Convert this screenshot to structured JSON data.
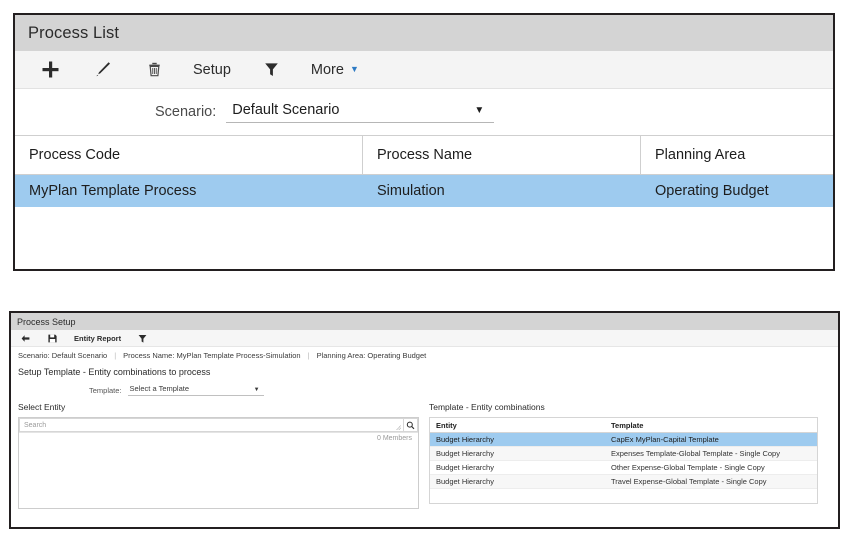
{
  "process_list": {
    "title": "Process List",
    "toolbar": [
      {
        "name": "add",
        "icon": "plus-icon",
        "label": ""
      },
      {
        "name": "edit",
        "icon": "pencil-icon",
        "label": ""
      },
      {
        "name": "delete",
        "icon": "trash-icon",
        "label": ""
      },
      {
        "name": "setup",
        "icon": "",
        "label": "Setup"
      },
      {
        "name": "filter",
        "icon": "funnel-icon",
        "label": ""
      },
      {
        "name": "more",
        "icon": "",
        "label": "More",
        "caret": "▼"
      }
    ],
    "scenario": {
      "label": "Scenario:",
      "value": "Default Scenario",
      "caret": "▼"
    },
    "grid": {
      "columns": [
        "Process Code",
        "Process Name",
        "Planning Area"
      ],
      "rows": [
        {
          "process_code": "MyPlan Template Process",
          "process_name": "Simulation",
          "planning_area": "Operating Budget",
          "selected": true
        }
      ]
    }
  },
  "process_setup": {
    "title": "Process Setup",
    "toolbar": [
      {
        "name": "back",
        "icon": "back-arrow-icon",
        "label": ""
      },
      {
        "name": "save",
        "icon": "save-disk-icon",
        "label": ""
      },
      {
        "name": "entity-report",
        "icon": "",
        "label": "Entity Report"
      },
      {
        "name": "filter",
        "icon": "funnel-icon",
        "label": ""
      }
    ],
    "breadcrumb": {
      "scenario": "Scenario: Default Scenario",
      "process_name": "Process Name: MyPlan Template Process-Simulation",
      "planning_area": "Planning Area: Operating Budget",
      "separator": "|"
    },
    "section_title": "Setup Template - Entity combinations to process",
    "template_select": {
      "label": "Template:",
      "value": "Select a Template",
      "caret": "▼"
    },
    "select_entity": {
      "heading": "Select Entity",
      "search_placeholder": "Search",
      "search_value": "",
      "search_icon": "magnifier-icon",
      "members_count": "0 Members"
    },
    "combinations": {
      "heading": "Template - Entity combinations",
      "columns": [
        "Entity",
        "Template"
      ],
      "rows": [
        {
          "entity": "Budget Hierarchy",
          "template": "CapEx MyPlan-Capital Template",
          "selected": true
        },
        {
          "entity": "Budget Hierarchy",
          "template": "Expenses Template-Global Template - Single Copy",
          "selected": false
        },
        {
          "entity": "Budget Hierarchy",
          "template": "Other Expense-Global Template - Single Copy",
          "selected": false
        },
        {
          "entity": "Budget Hierarchy",
          "template": "Travel Expense-Global Template - Single Copy",
          "selected": false
        }
      ]
    }
  },
  "colors": {
    "selection_blue": "#9ecbef",
    "titlebar_gray": "#d4d4d4",
    "toolbar_gray": "#f4f4f4",
    "accent_blue": "#2e7bc4",
    "panel_border": "#231f20"
  }
}
